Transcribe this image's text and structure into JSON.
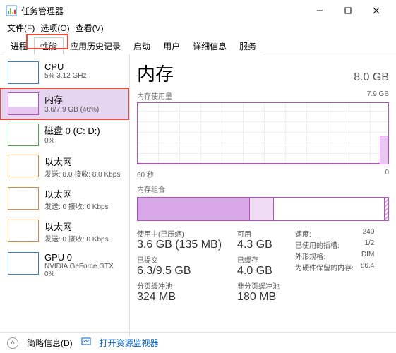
{
  "window": {
    "title": "任务管理器"
  },
  "menu": {
    "file": "文件(F)",
    "options": "选项(O)",
    "view": "查看(V)"
  },
  "tabs": {
    "processes": "进程",
    "performance": "性能",
    "app_history": "应用历史记录",
    "startup": "启动",
    "users": "用户",
    "details": "详细信息",
    "services": "服务"
  },
  "sidebar": {
    "cpu": {
      "title": "CPU",
      "sub": "5% 3.12 GHz"
    },
    "mem": {
      "title": "内存",
      "sub": "3.6/7.9 GB (46%)"
    },
    "disk": {
      "title": "磁盘 0 (C: D:)",
      "sub": "0%"
    },
    "eth1": {
      "title": "以太网",
      "sub": "发送: 8.0 接收: 8.0 Kbps"
    },
    "eth2": {
      "title": "以太网",
      "sub": "发送: 0 接收: 0 Kbps"
    },
    "eth3": {
      "title": "以太网",
      "sub": "发送: 0 接收: 0 Kbps"
    },
    "gpu": {
      "title": "GPU 0",
      "sub": "NVIDIA GeForce GTX",
      "sub2": "0%"
    }
  },
  "main": {
    "title": "内存",
    "capacity": "8.0 GB",
    "usage_label": "内存使用量",
    "usage_max": "7.9 GB",
    "time_label": "60 秒",
    "time_zero": "0",
    "composition_label": "内存组合",
    "in_use_label": "使用中(已压缩)",
    "in_use": "3.6 GB (135 MB)",
    "available_label": "可用",
    "available": "4.3 GB",
    "committed_label": "已提交",
    "committed": "6.3/9.5 GB",
    "cached_label": "已缓存",
    "cached": "4.0 GB",
    "paged_label": "分页缓冲池",
    "paged": "324 MB",
    "nonpaged_label": "非分页缓冲池",
    "nonpaged": "180 MB",
    "speed_label": "速度:",
    "speed": "240",
    "slots_label": "已使用的插槽:",
    "slots": "1/2",
    "form_label": "外形规格:",
    "form": "DIM",
    "reserved_label": "为硬件保留的内存:",
    "reserved": "86.4"
  },
  "footer": {
    "fewer": "简略信息(D)",
    "monitor": "打开资源监视器"
  },
  "chart_data": {
    "type": "area",
    "title": "内存使用量",
    "ylabel": "GB",
    "ylim": [
      0,
      7.9
    ],
    "xrange_seconds": 60,
    "series": [
      {
        "name": "使用中",
        "values_gb": [
          0,
          0,
          0,
          0,
          0,
          0,
          0,
          0,
          0,
          0,
          0,
          3.6
        ]
      }
    ],
    "composition": {
      "in_use_gb": 3.6,
      "modified_gb": 0.7,
      "standby_gb": 3.5,
      "hardware_reserved_gb": 0.1,
      "total_gb": 7.9
    }
  }
}
